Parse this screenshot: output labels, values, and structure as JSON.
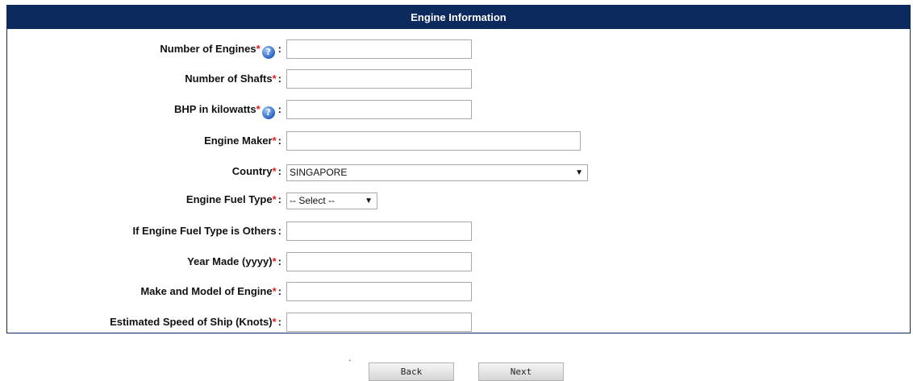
{
  "panel": {
    "title": "Engine Information",
    "required_mark": "*",
    "help_glyph": "?",
    "colon": ":"
  },
  "fields": {
    "number_of_engines": {
      "label": "Number of Engines",
      "value": ""
    },
    "number_of_shafts": {
      "label": "Number of Shafts",
      "value": ""
    },
    "bhp_kilowatts": {
      "label": "BHP in kilowatts",
      "value": ""
    },
    "engine_maker": {
      "label": "Engine Maker",
      "value": ""
    },
    "country": {
      "label": "Country",
      "value": "SINGAPORE"
    },
    "fuel_type": {
      "label": "Engine Fuel Type",
      "value": "-- Select --"
    },
    "fuel_type_other": {
      "label": "If Engine Fuel Type is Others",
      "value": ""
    },
    "year_made": {
      "label": "Year Made (yyyy)",
      "value": ""
    },
    "make_model": {
      "label": "Make and Model of Engine",
      "value": ""
    },
    "est_speed": {
      "label": "Estimated Speed of Ship (Knots)",
      "value": ""
    }
  },
  "buttons": {
    "tick_mark": "`",
    "back": "Back",
    "next": "Next"
  },
  "icons": {
    "help": "help-question-icon",
    "dropdown": "dropdown-arrow-icon"
  },
  "colors": {
    "header_bg": "#0d2a5e",
    "required": "#e01b1b"
  }
}
